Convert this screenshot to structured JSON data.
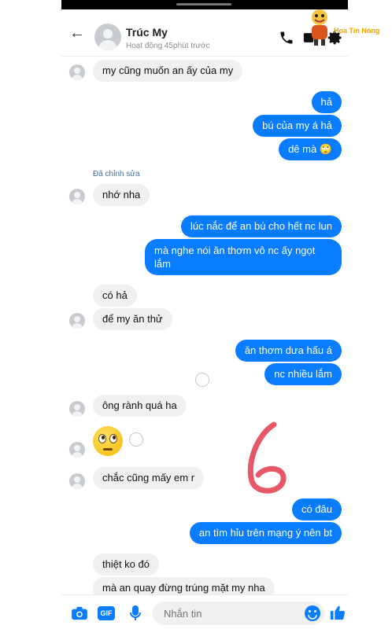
{
  "header": {
    "back_icon": "arrow-left-icon",
    "contact_name": "Trúc My",
    "status": "Hoạt động 45phút trước",
    "icons": [
      "phone-icon",
      "video-icon",
      "gear-icon"
    ]
  },
  "watermark": {
    "text": "Hoa Tin Nóng"
  },
  "messages": [
    {
      "side": "in",
      "text": "my cũng muốn an ấy của my"
    },
    {
      "side": "out",
      "text": "hả"
    },
    {
      "side": "out",
      "text": "bú của my á hả"
    },
    {
      "side": "out",
      "text": "dê mà 🙄"
    },
    {
      "side": "in",
      "text": "nhớ nha",
      "edited": "Đã chỉnh sửa"
    },
    {
      "side": "out",
      "text": "lúc nắc để an bú cho hết nc lun"
    },
    {
      "side": "out",
      "text": "mà nghe nói ăn thơm vô nc ấy ngọt lắm"
    },
    {
      "side": "in",
      "text": "có hả"
    },
    {
      "side": "in",
      "text": "để my ăn thử"
    },
    {
      "side": "out",
      "text": "ăn thơm dưa hấu á"
    },
    {
      "side": "out",
      "text": "nc nhiều lắm"
    },
    {
      "side": "in",
      "text": "ông rành quá ha"
    },
    {
      "side": "in",
      "text": "🙄"
    },
    {
      "side": "in",
      "text": "chắc cũng mấy em r"
    },
    {
      "side": "out",
      "text": "có đâu"
    },
    {
      "side": "out",
      "text": "an tìm hỉu trên mạng ý nên bt"
    },
    {
      "side": "in",
      "text": "thiệt ko đó"
    },
    {
      "side": "in",
      "text": "mà an quay đừng trúng mặt my nha"
    }
  ],
  "composer": {
    "placeholder": "Nhắn tin",
    "gif_label": "GIF",
    "icons": [
      "camera-icon",
      "gif-icon",
      "microphone-icon",
      "smiley-icon",
      "thumbs-up-icon"
    ]
  },
  "colors": {
    "outgoing": "#0a7cff",
    "incoming": "#f0f0f0"
  }
}
